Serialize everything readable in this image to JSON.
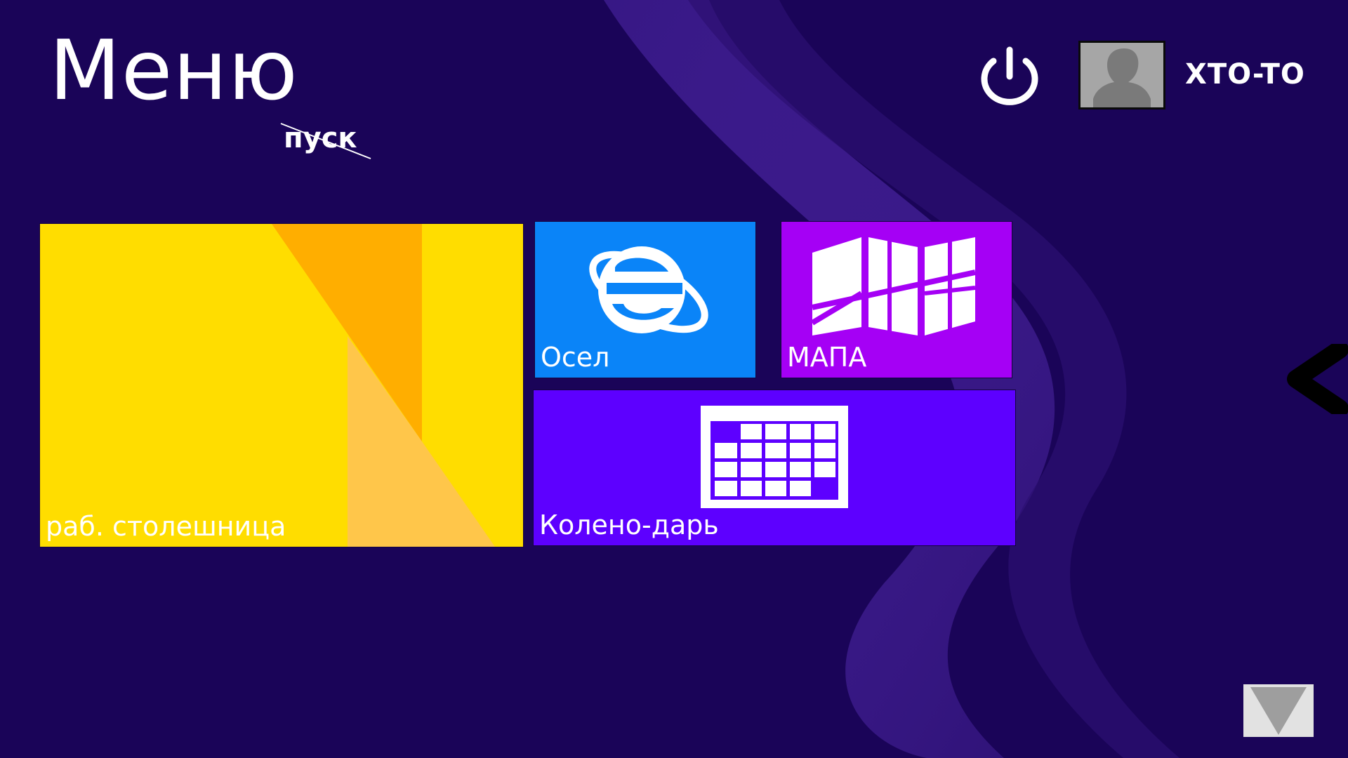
{
  "header": {
    "title": "Меню",
    "subtitle": "пуск"
  },
  "user": {
    "name": "XTO-TO"
  },
  "tiles": [
    {
      "label": "раб. столешница",
      "color": "#ffdd00",
      "icon": "desktop-wallpaper-icon"
    },
    {
      "label": "Осел",
      "color": "#0a84f8",
      "icon": "internet-explorer-icon"
    },
    {
      "label": "МАПА",
      "color": "#a500f5",
      "icon": "map-icon"
    },
    {
      "label": "Колено-дарь",
      "color": "#5d00ff",
      "icon": "calendar-icon"
    }
  ],
  "colors": {
    "background": "#1a0458",
    "swirl": "#4a24a8",
    "accent_text": "#ffffff"
  },
  "icons": {
    "power": "power-icon",
    "avatar": "user-avatar-icon",
    "expand": "chevron-left-icon",
    "scroll": "scroll-down-arrow-icon"
  }
}
